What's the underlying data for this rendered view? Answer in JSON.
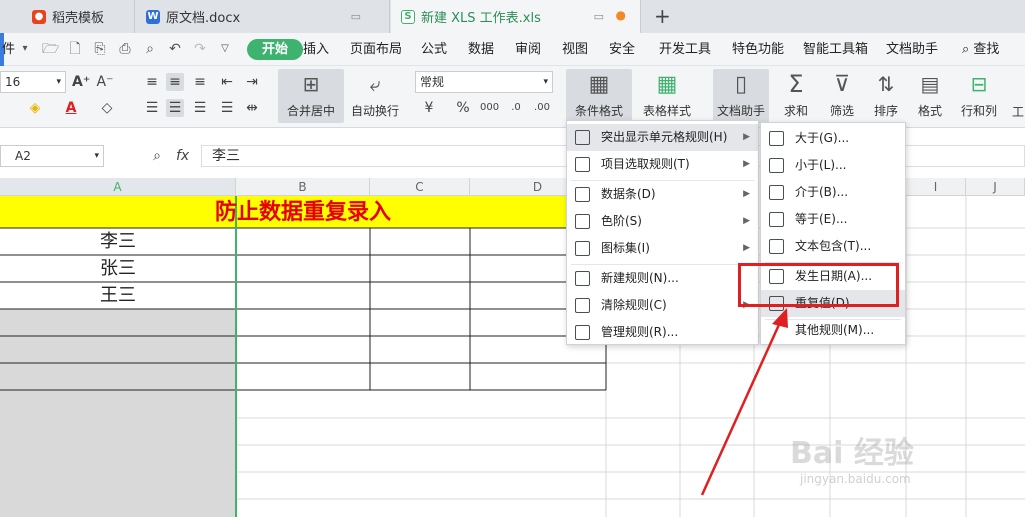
{
  "tabs": [
    {
      "label": "稻壳模板"
    },
    {
      "label": "原文档.docx"
    },
    {
      "label": "新建 XLS 工作表.xls"
    }
  ],
  "menubar": {
    "file_partial": "件",
    "start": "开始",
    "items": [
      "插入",
      "页面布局",
      "公式",
      "数据",
      "审阅",
      "视图",
      "安全",
      "开发工具",
      "特色功能",
      "智能工具箱",
      "文档助手"
    ],
    "search": "查找"
  },
  "ribbon": {
    "font_size": "16",
    "merge_center": "合并居中",
    "wrap_text": "自动换行",
    "number_format": "常规",
    "conditional_format": "条件格式",
    "table_style": "表格样式",
    "doc_helper": "文档助手",
    "sum": "求和",
    "filter": "筛选",
    "sort": "排序",
    "format": "格式",
    "row_col": "行和列",
    "work_partial": "工"
  },
  "formula": {
    "cell_ref": "A2",
    "fx": "fx",
    "value": "李三"
  },
  "columns": [
    "A",
    "B",
    "C",
    "D",
    "I",
    "J"
  ],
  "sheet": {
    "title": "防止数据重复录入",
    "names": [
      "李三",
      "张三",
      "王三"
    ]
  },
  "menu1": {
    "items": [
      "突出显示单元格规则(H)",
      "项目选取规则(T)",
      "数据条(D)",
      "色阶(S)",
      "图标集(I)",
      "新建规则(N)...",
      "清除规则(C)",
      "管理规则(R)..."
    ]
  },
  "menu2": {
    "items": [
      "大于(G)...",
      "小于(L)...",
      "介于(B)...",
      "等于(E)...",
      "文本包含(T)...",
      "发生日期(A)...",
      "重复值(D)...",
      "其他规则(M)..."
    ]
  },
  "watermark": {
    "brand": "Bai  经验",
    "url": "jingyan.baidu.com"
  },
  "colors": {
    "accent_green": "#3eb370",
    "title_bg": "#ffff00",
    "title_text": "#e60000",
    "annotation_red": "#e02020"
  }
}
